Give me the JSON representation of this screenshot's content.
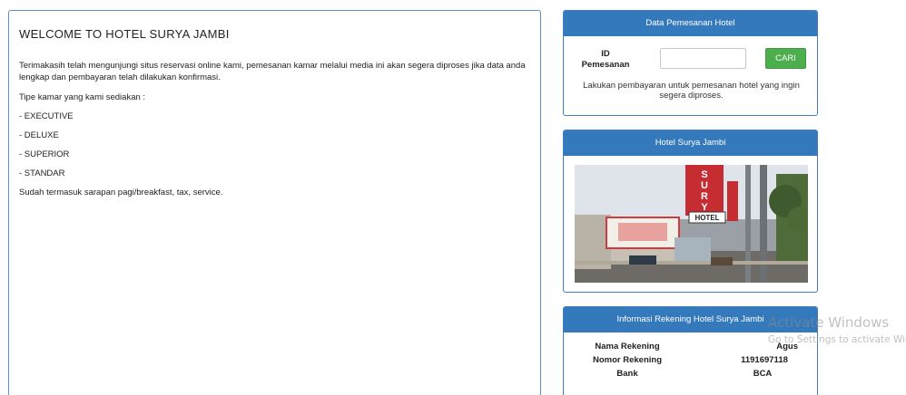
{
  "main": {
    "title": "WELCOME TO HOTEL SURYA JAMBI",
    "intro": "Terimakasih telah mengunjungi situs reservasi online kami, pemesanan kamar melalui media ini akan segera diproses jika data anda lengkap dan pembayaran telah dilakukan konfirmasi.",
    "types_heading": "Tipe kamar yang kami sediakan :",
    "room_types": [
      "- EXECUTIVE",
      "- DELUXE",
      "- SUPERIOR",
      "- STANDAR"
    ],
    "footer_note": "Sudah termasuk sarapan pagi/breakfast, tax, service."
  },
  "booking": {
    "header": "Data Pemesanan Hotel",
    "id_label": "ID Pemesanan",
    "id_value": "",
    "id_placeholder": "",
    "search_label": "CARI",
    "note": "Lakukan pembayaran untuk pemesanan hotel yang ingin segera diproses."
  },
  "hotel": {
    "header": "Hotel Surya Jambi",
    "sign_text": "SURYA",
    "hotel_sign": "HOTEL"
  },
  "rekening": {
    "header": "Informasi Rekening Hotel Surya Jambi",
    "rows": [
      {
        "label": "Nama Rekening",
        "value": "Agus"
      },
      {
        "label": "Nomor Rekening",
        "value": "1191697118"
      },
      {
        "label": "Bank",
        "value": "BCA"
      }
    ]
  },
  "watermark": {
    "title": "Activate Windows",
    "subtitle": "Go to Settings to activate Windows."
  },
  "colors": {
    "panel_header": "#3579bd",
    "button_green": "#4cae4c",
    "border_blue": "#5b8fc7"
  }
}
